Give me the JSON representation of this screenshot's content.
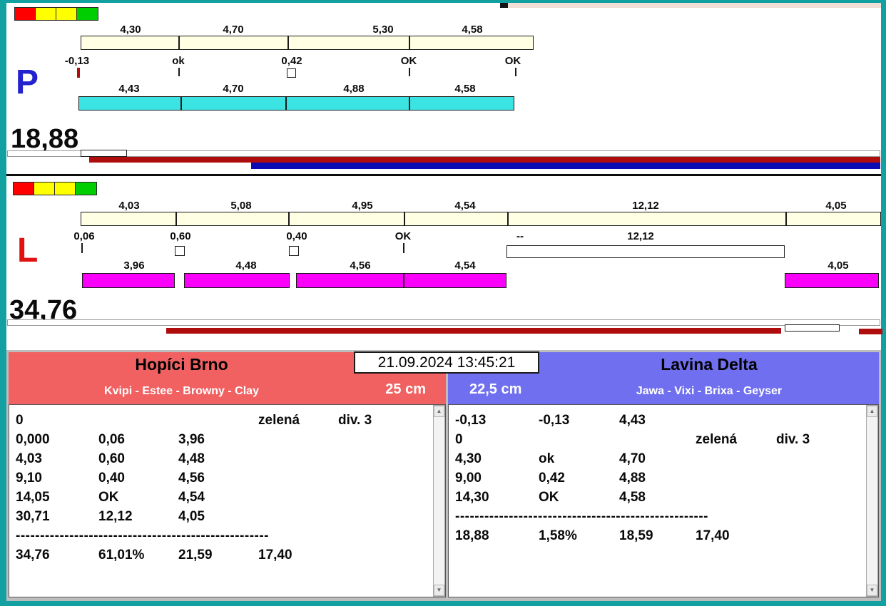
{
  "frame": {
    "teal": "#12A0A0",
    "strip": "#F2DFD6"
  },
  "icons": {
    "scroll_up": "▲",
    "scroll_down": "▼"
  },
  "panel_p": {
    "label": "P",
    "label_color": "#2222CF",
    "total": "18,88",
    "squares": [
      "#FF0000",
      "#FFFF00",
      "#FFFF00",
      "#00CE00"
    ],
    "top_values": [
      "4,30",
      "4,70",
      "5,30",
      "4,58"
    ],
    "mid_values": [
      "-0,13",
      "ok",
      "0,42",
      "OK",
      "OK"
    ],
    "bottom_values": [
      "4,43",
      "4,70",
      "4,88",
      "4,58"
    ],
    "track_top_color": "#FFFFE3",
    "track_bottom_color": "#3CE3E3",
    "progress_red": "#AF0D0D",
    "progress_blue": "#0B0BB4"
  },
  "panel_l": {
    "label": "L",
    "label_color": "#E11212",
    "total": "34,76",
    "squares": [
      "#FF0000",
      "#FFFF00",
      "#FFFF00",
      "#00CE00"
    ],
    "top_values": [
      "4,03",
      "5,08",
      "4,95",
      "4,54",
      "12,12",
      "4,05"
    ],
    "mid_values": [
      "0,06",
      "0,60",
      "0,40",
      "OK",
      "--",
      "12,12"
    ],
    "bottom_values": [
      "3,96",
      "4,48",
      "4,56",
      "4,54",
      "4,05"
    ],
    "track_top_color": "#FFFFE3",
    "track_bottom_color": "#FA00FA",
    "progress_red": "#AF0D0D"
  },
  "timestamp": "21.09.2024 13:45:21",
  "team_left": {
    "name": "Hopíci Brno",
    "members": "Kvipi - Estee - Browny - Clay",
    "height": "25 cm",
    "header_color": "#F16161",
    "rows": [
      [
        "0",
        "",
        "",
        "zelená",
        "div. 3"
      ],
      [
        "0,000",
        "0,06",
        "3,96",
        "",
        ""
      ],
      [
        "4,03",
        "0,60",
        "4,48",
        "",
        ""
      ],
      [
        "9,10",
        "0,40",
        "4,56",
        "",
        ""
      ],
      [
        "14,05",
        "OK",
        "4,54",
        "",
        ""
      ],
      [
        "30,71",
        "12,12",
        "4,05",
        "",
        ""
      ]
    ],
    "separator": "----------------------------------------------------",
    "summary": [
      "34,76",
      "61,01%",
      "21,59",
      "17,40"
    ]
  },
  "team_right": {
    "name": "Lavina Delta",
    "members": "Jawa - Vixi - Brixa - Geyser",
    "height": "22,5 cm",
    "header_color": "#6F6FF0",
    "rows": [
      [
        "-0,13",
        "-0,13",
        "4,43",
        "",
        ""
      ],
      [
        "0",
        "",
        "",
        "zelená",
        "div. 3"
      ],
      [
        "4,30",
        "ok",
        "4,70",
        "",
        ""
      ],
      [
        "9,00",
        "0,42",
        "4,88",
        "",
        ""
      ],
      [
        "14,30",
        "OK",
        "4,58",
        "",
        ""
      ]
    ],
    "separator": "----------------------------------------------------",
    "summary": [
      "18,88",
      "1,58%",
      "18,59",
      "17,40"
    ]
  }
}
